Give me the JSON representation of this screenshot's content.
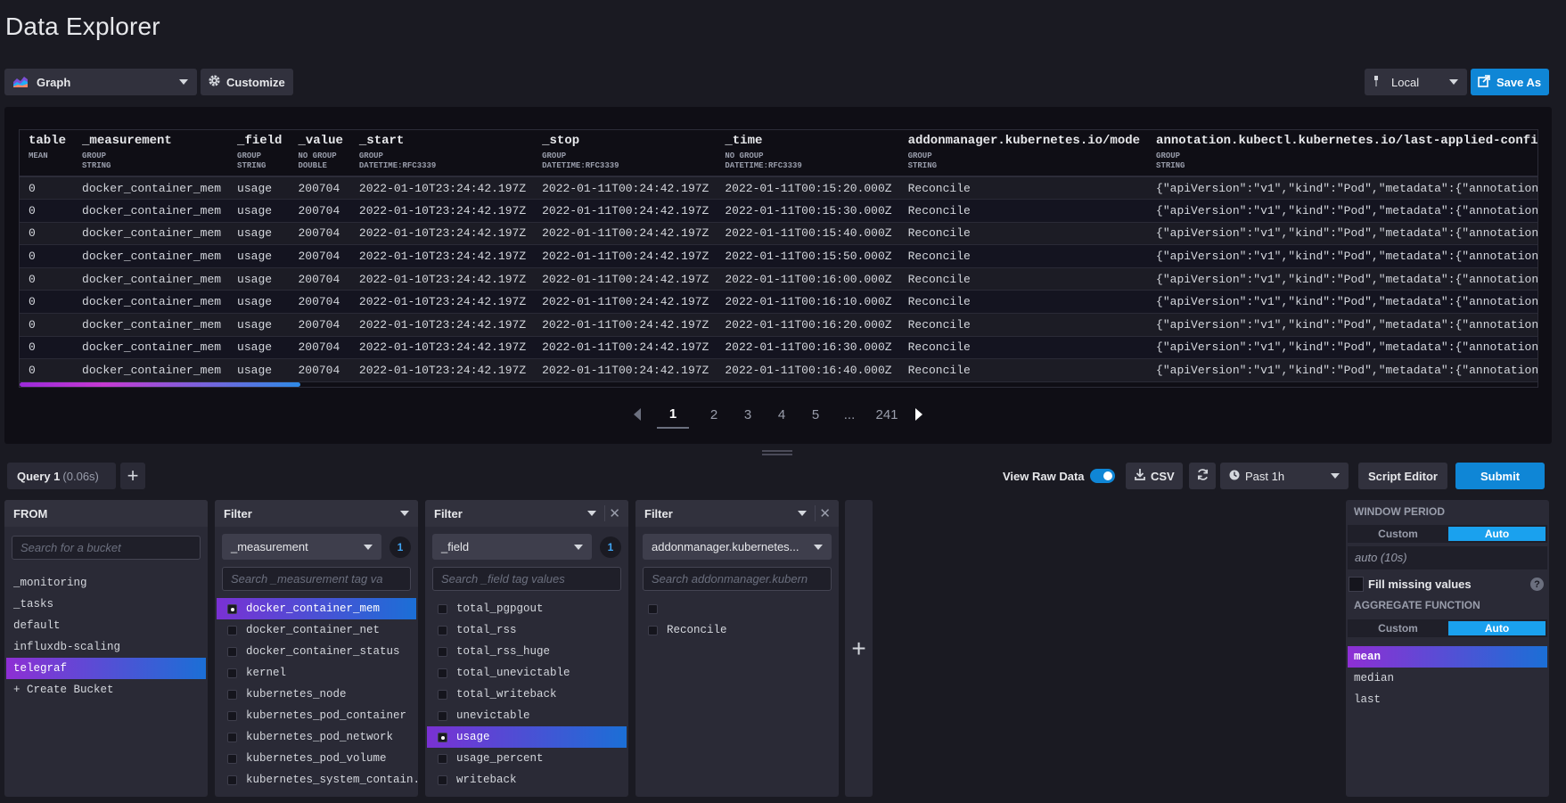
{
  "page_title": "Data Explorer",
  "toolbar": {
    "graph_label": "Graph",
    "customize_label": "Customize",
    "timezone_label": "Local",
    "save_as_label": "Save As"
  },
  "table": {
    "columns": [
      {
        "name": "table",
        "group": "MEAN",
        "type": ""
      },
      {
        "name": "_measurement",
        "group": "GROUP",
        "type": "STRING"
      },
      {
        "name": "_field",
        "group": "GROUP",
        "type": "STRING"
      },
      {
        "name": "_value",
        "group": "NO GROUP",
        "type": "DOUBLE"
      },
      {
        "name": "_start",
        "group": "GROUP",
        "type": "DATETIME:RFC3339"
      },
      {
        "name": "_stop",
        "group": "GROUP",
        "type": "DATETIME:RFC3339"
      },
      {
        "name": "_time",
        "group": "NO GROUP",
        "type": "DATETIME:RFC3339"
      },
      {
        "name": "addonmanager.kubernetes.io/mode",
        "group": "GROUP",
        "type": "STRING"
      },
      {
        "name": "annotation.kubectl.kubernetes.io/last-applied-configu",
        "group": "GROUP",
        "type": "STRING"
      }
    ],
    "rows": [
      [
        "0",
        "docker_container_mem",
        "usage",
        "200704",
        "2022-01-10T23:24:42.197Z",
        "2022-01-11T00:24:42.197Z",
        "2022-01-11T00:15:20.000Z",
        "Reconcile",
        "{\"apiVersion\":\"v1\",\"kind\":\"Pod\",\"metadata\":{\"annotation"
      ],
      [
        "0",
        "docker_container_mem",
        "usage",
        "200704",
        "2022-01-10T23:24:42.197Z",
        "2022-01-11T00:24:42.197Z",
        "2022-01-11T00:15:30.000Z",
        "Reconcile",
        "{\"apiVersion\":\"v1\",\"kind\":\"Pod\",\"metadata\":{\"annotation"
      ],
      [
        "0",
        "docker_container_mem",
        "usage",
        "200704",
        "2022-01-10T23:24:42.197Z",
        "2022-01-11T00:24:42.197Z",
        "2022-01-11T00:15:40.000Z",
        "Reconcile",
        "{\"apiVersion\":\"v1\",\"kind\":\"Pod\",\"metadata\":{\"annotation"
      ],
      [
        "0",
        "docker_container_mem",
        "usage",
        "200704",
        "2022-01-10T23:24:42.197Z",
        "2022-01-11T00:24:42.197Z",
        "2022-01-11T00:15:50.000Z",
        "Reconcile",
        "{\"apiVersion\":\"v1\",\"kind\":\"Pod\",\"metadata\":{\"annotation"
      ],
      [
        "0",
        "docker_container_mem",
        "usage",
        "200704",
        "2022-01-10T23:24:42.197Z",
        "2022-01-11T00:24:42.197Z",
        "2022-01-11T00:16:00.000Z",
        "Reconcile",
        "{\"apiVersion\":\"v1\",\"kind\":\"Pod\",\"metadata\":{\"annotation"
      ],
      [
        "0",
        "docker_container_mem",
        "usage",
        "200704",
        "2022-01-10T23:24:42.197Z",
        "2022-01-11T00:24:42.197Z",
        "2022-01-11T00:16:10.000Z",
        "Reconcile",
        "{\"apiVersion\":\"v1\",\"kind\":\"Pod\",\"metadata\":{\"annotation"
      ],
      [
        "0",
        "docker_container_mem",
        "usage",
        "200704",
        "2022-01-10T23:24:42.197Z",
        "2022-01-11T00:24:42.197Z",
        "2022-01-11T00:16:20.000Z",
        "Reconcile",
        "{\"apiVersion\":\"v1\",\"kind\":\"Pod\",\"metadata\":{\"annotation"
      ],
      [
        "0",
        "docker_container_mem",
        "usage",
        "200704",
        "2022-01-10T23:24:42.197Z",
        "2022-01-11T00:24:42.197Z",
        "2022-01-11T00:16:30.000Z",
        "Reconcile",
        "{\"apiVersion\":\"v1\",\"kind\":\"Pod\",\"metadata\":{\"annotation"
      ],
      [
        "0",
        "docker_container_mem",
        "usage",
        "200704",
        "2022-01-10T23:24:42.197Z",
        "2022-01-11T00:24:42.197Z",
        "2022-01-11T00:16:40.000Z",
        "Reconcile",
        "{\"apiVersion\":\"v1\",\"kind\":\"Pod\",\"metadata\":{\"annotation"
      ]
    ]
  },
  "pagination": {
    "pages": [
      "1",
      "2",
      "3",
      "4",
      "5"
    ],
    "ellipsis": "...",
    "last": "241",
    "active": "1"
  },
  "query_bar": {
    "query_name": "Query 1",
    "query_time": "(0.06s)",
    "add_label": "+",
    "view_raw_label": "View Raw Data",
    "view_raw_on": true,
    "csv_label": "CSV",
    "time_range_label": "Past 1h",
    "script_editor_label": "Script Editor",
    "submit_label": "Submit"
  },
  "from_card": {
    "title": "FROM",
    "search_placeholder": "Search for a bucket",
    "buckets": [
      "_monitoring",
      "_tasks",
      "default",
      "influxdb-scaling",
      "telegraf",
      "+ Create Bucket"
    ],
    "selected": "telegraf"
  },
  "filter1": {
    "title": "Filter",
    "key": "_measurement",
    "count": "1",
    "search_placeholder": "Search _measurement tag va",
    "values": [
      "docker_container_mem",
      "docker_container_net",
      "docker_container_status",
      "kernel",
      "kubernetes_node",
      "kubernetes_pod_container",
      "kubernetes_pod_network",
      "kubernetes_pod_volume",
      "kubernetes_system_contain..."
    ],
    "selected": "docker_container_mem"
  },
  "filter2": {
    "title": "Filter",
    "key": "_field",
    "count": "1",
    "search_placeholder": "Search _field tag values",
    "values": [
      "total_pgpgout",
      "total_rss",
      "total_rss_huge",
      "total_unevictable",
      "total_writeback",
      "unevictable",
      "usage",
      "usage_percent",
      "writeback"
    ],
    "selected": "usage"
  },
  "filter3": {
    "title": "Filter",
    "key": "addonmanager.kubernetes...",
    "search_placeholder": "Search addonmanager.kubern",
    "values": [
      "",
      "Reconcile"
    ]
  },
  "add_filter_label": "+",
  "aggregate": {
    "window_title": "WINDOW PERIOD",
    "window_custom": "Custom",
    "window_auto": "Auto",
    "window_value": "auto (10s)",
    "fill_label": "Fill missing values",
    "help": "?",
    "function_title": "AGGREGATE FUNCTION",
    "function_custom": "Custom",
    "function_auto": "Auto",
    "functions": [
      "mean",
      "median",
      "last"
    ],
    "selected": "mean"
  },
  "colors": {
    "accent_blue": "#0f86d6",
    "selection_start": "#8e2fd4",
    "selection_end": "#1b6fd6",
    "background": "#1a1a22",
    "panel": "#0f0e15"
  },
  "icons": [
    "graph-icon",
    "gear-icon",
    "pin-icon",
    "export-icon",
    "download-icon",
    "refresh-icon",
    "clock-icon",
    "close-icon"
  ]
}
